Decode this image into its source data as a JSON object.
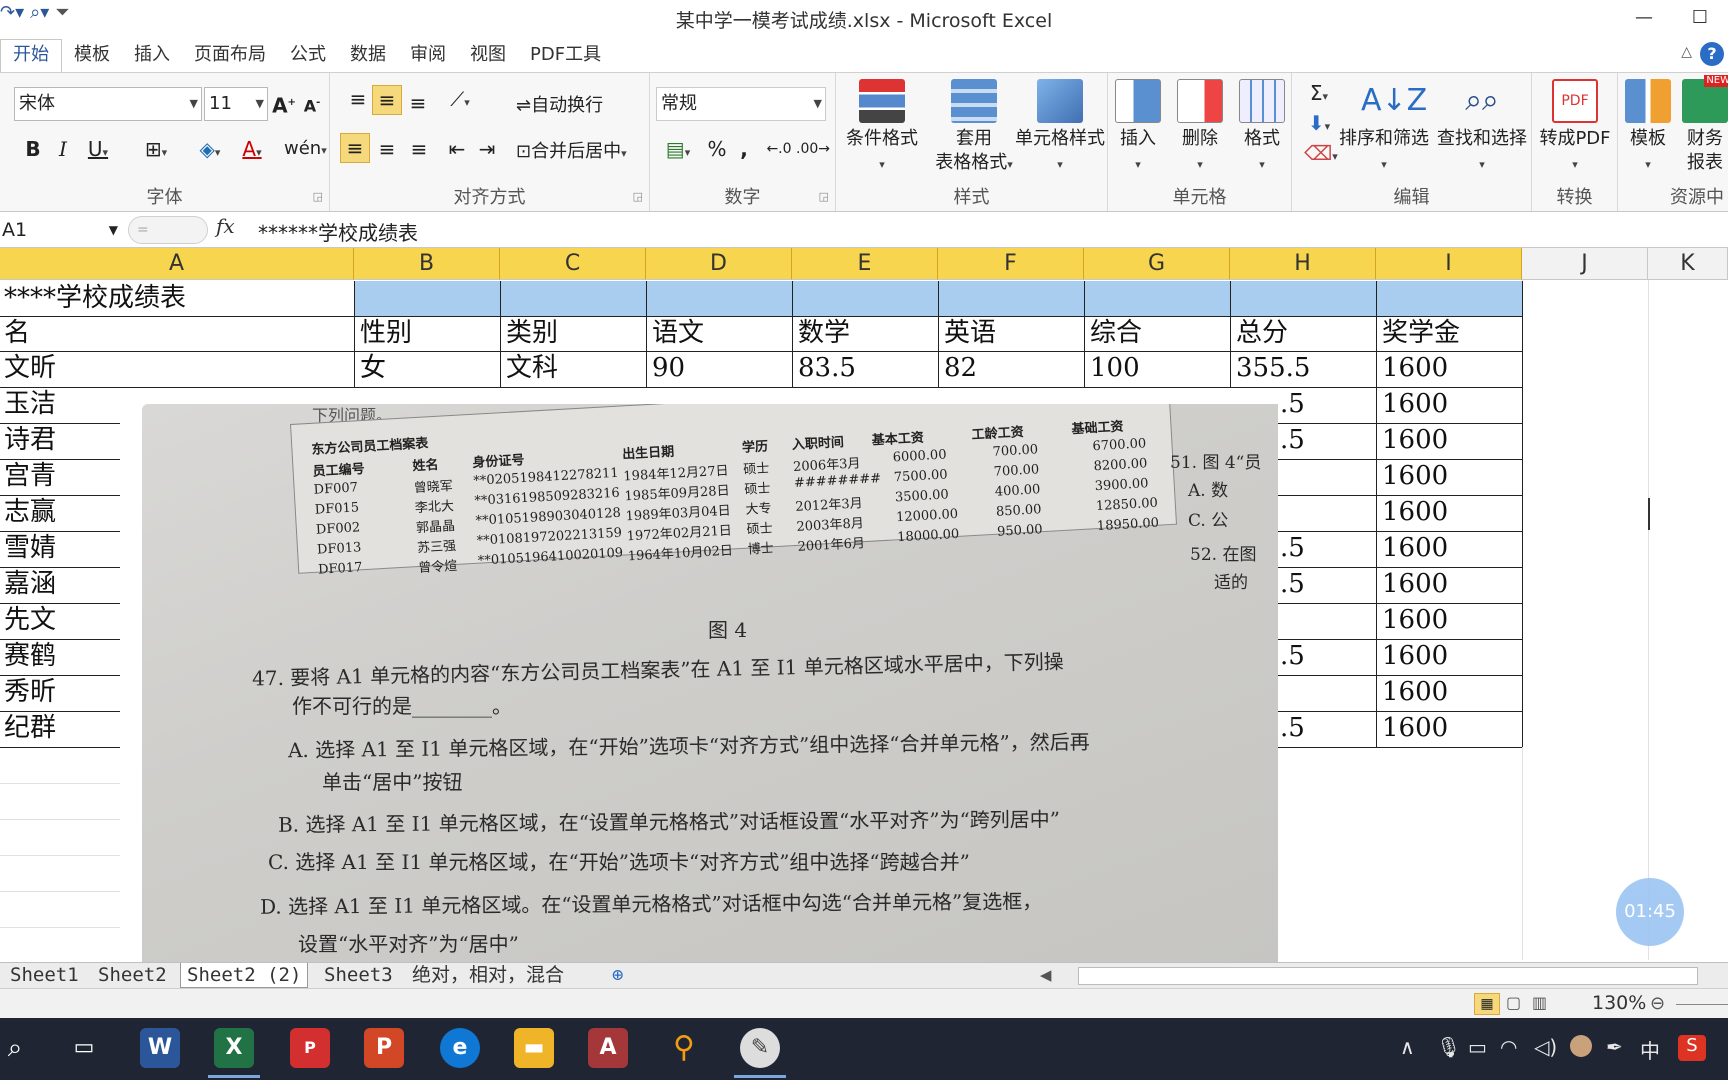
{
  "window": {
    "title": "某中学一模考试成绩.xlsx - Microsoft Excel"
  },
  "ribbon_tabs": [
    "开始",
    "模板",
    "插入",
    "页面布局",
    "公式",
    "数据",
    "审阅",
    "视图",
    "PDF工具"
  ],
  "font_group": {
    "font_name": "宋体",
    "font_size": "11",
    "label": "字体"
  },
  "align_group": {
    "wrap": "自动换行",
    "merge": "合并后居中",
    "label": "对齐方式"
  },
  "number_group": {
    "format": "常规",
    "percent": "%",
    "comma": ",",
    "label": "数字"
  },
  "styles_group": {
    "cond": "条件格式",
    "table_fmt_1": "套用",
    "table_fmt_2": "表格格式",
    "cell_style": "单元格样式",
    "label": "样式"
  },
  "cells_group": {
    "insert": "插入",
    "delete": "删除",
    "format": "格式",
    "label": "单元格"
  },
  "edit_group": {
    "sort": "排序和筛选",
    "find": "查找和选择",
    "label": "编辑"
  },
  "convert_group": {
    "pdf": "转成PDF",
    "label": "转换"
  },
  "resource_group": {
    "template": "模板",
    "finance_1": "财务",
    "finance_2": "报表",
    "label": "资源中",
    "badge": "NEW"
  },
  "formula_bar": {
    "name_box": "A1",
    "fx": "fx",
    "content": "******学校成绩表"
  },
  "columns": [
    "A",
    "B",
    "C",
    "D",
    "E",
    "F",
    "G",
    "H",
    "I",
    "J",
    "K"
  ],
  "sheet": {
    "title_cell": "****学校成绩表",
    "headers": [
      "名",
      "性别",
      "类别",
      "语文",
      "数学",
      "英语",
      "综合",
      "总分",
      "奖学金"
    ],
    "first_row": [
      "文昕",
      "女",
      "文科",
      "90",
      "83.5",
      "82",
      "100",
      "355.5",
      "1600"
    ],
    "names_visible": [
      "玉洁",
      "诗君",
      "宫青",
      "志赢",
      "雪婧",
      "嘉涵",
      "先文",
      "赛鹤",
      "秀昕",
      "纪群"
    ],
    "h_partial": [
      ".5",
      ".5",
      "",
      "",
      ".5",
      ".5",
      "",
      ".5",
      "",
      ".5"
    ],
    "scholarship": [
      "1600",
      "1600",
      "1600",
      "1600",
      "1600",
      "1600",
      "1600",
      "1600",
      "1600",
      "1600"
    ]
  },
  "photo": {
    "header_text": "下列问题。",
    "table_title": "东方公司员工档案表",
    "table_cols": [
      "员工编号",
      "姓名",
      "身份证号",
      "出生日期",
      "学历",
      "入职时间",
      "基本工资",
      "工龄工资",
      "基础工资"
    ],
    "table_rows": [
      [
        "DF007",
        "曾晓军",
        "**0205198412278211",
        "1984年12月27日",
        "硕士",
        "2006年3月",
        "6000.00",
        "700.00",
        "6700.00"
      ],
      [
        "DF015",
        "李北大",
        "**0316198509283216",
        "1985年09月28日",
        "硕士",
        "########",
        "7500.00",
        "700.00",
        "8200.00"
      ],
      [
        "DF002",
        "郭晶晶",
        "**0105198903040128",
        "1989年03月04日",
        "大专",
        "2012年3月",
        "3500.00",
        "400.00",
        "3900.00"
      ],
      [
        "DF013",
        "苏三强",
        "**0108197202213159",
        "1972年02月21日",
        "硕士",
        "2003年8月",
        "12000.00",
        "850.00",
        "12850.00"
      ],
      [
        "DF017",
        "曾令煊",
        "**0105196410020109",
        "1964年10月02日",
        "博士",
        "2001年6月",
        "18000.00",
        "950.00",
        "18950.00"
      ]
    ],
    "figure_caption": "图 4",
    "q47": "47. 要将 A1 单元格的内容“东方公司员工档案表”在 A1 至 I1 单元格区域水平居中，下列操",
    "q47b": "作不可行的是________。",
    "optA": "A. 选择 A1 至 I1 单元格区域，在“开始”选项卡“对齐方式”组中选择“合并单元格”，然后再",
    "optA2": "单击“居中”按钮",
    "optB": "B. 选择 A1 至 I1 单元格区域，在“设置单元格格式”对话框设置“水平对齐”为“跨列居中”",
    "optC": "C. 选择 A1 至 I1 单元格区域，在“开始”选项卡“对齐方式”组中选择“跨越合并”",
    "optD": "D. 选择 A1 至 I1 单元格区域。在“设置单元格格式”对话框中勾选“合并单元格”复选框，",
    "optD2": "设置“水平对齐”为“居中”",
    "side_51": "51. 图 4“员",
    "side_51a": "A. 数",
    "side_51c": "C. 公",
    "side_52": "52. 在图",
    "side_52b": "适的"
  },
  "sheet_tabs": [
    "Sheet1",
    "Sheet2",
    "Sheet2 (2)",
    "Sheet3",
    "绝对，相对，混合"
  ],
  "status": {
    "zoom": "130%"
  },
  "timer": "01:45",
  "taskbar": {
    "ime": "中"
  },
  "colors": {
    "selected_col": "#f8d54e",
    "highlight_row": "#a9cdee",
    "ribbon_bg": "#f7f7f7",
    "taskbar": "#1f2533"
  }
}
